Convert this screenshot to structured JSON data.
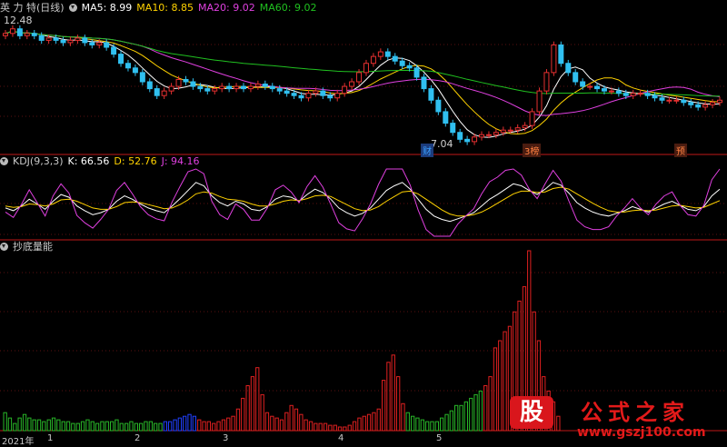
{
  "header": {
    "stock": "英 力 特(日线)",
    "ma": [
      {
        "label": "MA5: 8.99",
        "color": "#ffffff"
      },
      {
        "label": "MA10: 8.85",
        "color": "#ffd200"
      },
      {
        "label": "MA20: 9.02",
        "color": "#e040e0"
      },
      {
        "label": "MA60: 9.02",
        "color": "#20c020"
      }
    ]
  },
  "price_annotations": {
    "high": "12.48",
    "low": "7.04"
  },
  "markers": [
    {
      "text": "财",
      "color": "#3aa0ff"
    },
    {
      "text": "3榜",
      "color": "#ff8040"
    },
    {
      "text": "预",
      "color": "#ff8040"
    }
  ],
  "kdj": {
    "title": "KDJ(9,3,3)",
    "k": "K: 66.56",
    "d": "D: 52.76",
    "j": "J: 94.16",
    "k_color": "#ffffff",
    "d_color": "#ffd200",
    "j_color": "#e040e0"
  },
  "vol": {
    "title": "抄底量能"
  },
  "xaxis": {
    "labels": [
      "2021年",
      "1",
      "2",
      "3",
      "4",
      "5"
    ]
  },
  "watermark": {
    "logo": "股",
    "name": "公式之家",
    "url": "www.gszj100.com"
  },
  "chart_data": [
    {
      "type": "candlestick",
      "title": "英 力 特(日线)",
      "annotations": [
        "12.48",
        "7.04"
      ],
      "moving_averages": [
        "MA5",
        "MA10",
        "MA20",
        "MA60"
      ],
      "closes": [
        11.9,
        12.1,
        11.8,
        11.9,
        11.8,
        11.6,
        11.7,
        11.6,
        11.5,
        11.6,
        11.7,
        11.5,
        11.4,
        11.5,
        11.3,
        11.0,
        10.6,
        10.4,
        10.2,
        9.8,
        9.5,
        9.2,
        9.4,
        9.6,
        9.9,
        9.8,
        9.6,
        9.5,
        9.4,
        9.5,
        9.6,
        9.5,
        9.6,
        9.5,
        9.6,
        9.7,
        9.6,
        9.5,
        9.4,
        9.3,
        9.2,
        9.1,
        9.3,
        9.4,
        9.2,
        9.1,
        9.3,
        9.6,
        9.8,
        10.2,
        10.6,
        10.9,
        11.1,
        10.9,
        10.7,
        10.5,
        10.4,
        10.0,
        9.5,
        9.0,
        8.5,
        8.0,
        7.6,
        7.3,
        7.2,
        7.4,
        7.5,
        7.5,
        7.6,
        7.7,
        7.7,
        7.8,
        7.9,
        8.5,
        9.4,
        10.2,
        11.4,
        10.6,
        10.2,
        9.8,
        9.6,
        9.6,
        9.5,
        9.4,
        9.4,
        9.3,
        9.2,
        9.3,
        9.3,
        9.2,
        9.1,
        9.0,
        9.0,
        9.0,
        8.9,
        8.8,
        8.7,
        8.8,
        8.9,
        9.0
      ]
    },
    {
      "type": "line",
      "title": "KDJ(9,3,3)",
      "series": [
        {
          "name": "K",
          "values": [
            42,
            38,
            45,
            55,
            48,
            40,
            52,
            62,
            58,
            45,
            38,
            32,
            35,
            40,
            52,
            60,
            55,
            48,
            42,
            38,
            35,
            45,
            56,
            68,
            80,
            75,
            60,
            50,
            45,
            52,
            48,
            40,
            38,
            44,
            55,
            60,
            58,
            52,
            62,
            70,
            65,
            55,
            42,
            35,
            30,
            34,
            42,
            55,
            68,
            75,
            80,
            70,
            55,
            40,
            30,
            25,
            22,
            26,
            30,
            35,
            45,
            55,
            62,
            70,
            78,
            75,
            68,
            62,
            70,
            80,
            76,
            64,
            50,
            42,
            36,
            32,
            30,
            34,
            38,
            44,
            40,
            36,
            42,
            48,
            52,
            46,
            40,
            38,
            44,
            60,
            70
          ]
        },
        {
          "name": "D",
          "values": [
            45,
            43,
            44,
            48,
            47,
            45,
            48,
            54,
            55,
            52,
            47,
            42,
            40,
            40,
            44,
            50,
            51,
            50,
            47,
            44,
            41,
            42,
            47,
            54,
            63,
            66,
            64,
            59,
            55,
            54,
            52,
            48,
            45,
            45,
            48,
            52,
            54,
            53,
            56,
            60,
            61,
            59,
            53,
            47,
            41,
            38,
            39,
            44,
            52,
            59,
            66,
            67,
            63,
            55,
            47,
            39,
            33,
            30,
            30,
            32,
            36,
            42,
            49,
            56,
            63,
            67,
            67,
            65,
            66,
            71,
            73,
            70,
            63,
            56,
            49,
            43,
            38,
            36,
            36,
            38,
            39,
            38,
            39,
            42,
            45,
            46,
            44,
            42,
            43,
            48,
            53
          ]
        },
        {
          "name": "J",
          "values": [
            36,
            28,
            47,
            69,
            50,
            30,
            60,
            78,
            64,
            31,
            20,
            12,
            25,
            40,
            68,
            80,
            63,
            44,
            32,
            26,
            23,
            51,
            74,
            96,
            100,
            93,
            52,
            32,
            25,
            48,
            40,
            24,
            24,
            42,
            69,
            76,
            66,
            50,
            74,
            90,
            73,
            47,
            20,
            11,
            8,
            26,
            48,
            77,
            100,
            100,
            100,
            76,
            39,
            10,
            0,
            0,
            0,
            18,
            30,
            41,
            63,
            81,
            88,
            98,
            100,
            91,
            70,
            56,
            78,
            98,
            82,
            52,
            24,
            14,
            10,
            10,
            14,
            30,
            42,
            56,
            42,
            32,
            48,
            60,
            66,
            46,
            32,
            30,
            46,
            84,
            100
          ]
        }
      ]
    },
    {
      "type": "bar",
      "title": "抄底量能",
      "values": [
        10,
        7,
        4,
        7,
        9,
        7,
        6,
        6,
        5,
        6,
        7,
        6,
        5,
        5,
        4,
        4,
        5,
        6,
        5,
        4,
        5,
        5,
        5,
        6,
        4,
        4,
        5,
        4,
        4,
        5,
        5,
        4,
        4,
        5,
        5,
        6,
        7,
        8,
        9,
        8,
        6,
        5,
        5,
        4,
        5,
        6,
        7,
        8,
        12,
        18,
        25,
        30,
        35,
        20,
        10,
        8,
        7,
        6,
        10,
        14,
        12,
        9,
        6,
        5,
        4,
        4,
        4,
        3,
        3,
        2,
        2,
        3,
        5,
        7,
        8,
        9,
        10,
        12,
        28,
        38,
        42,
        30,
        15,
        10,
        8,
        7,
        6,
        5,
        5,
        5,
        7,
        9,
        11,
        14,
        14,
        16,
        18,
        20,
        22,
        25,
        30,
        46,
        50,
        55,
        58,
        66,
        72,
        80,
        100,
        66,
        50,
        30,
        22,
        16,
        8
      ],
      "colors": [
        "g",
        "g",
        "g",
        "g",
        "g",
        "g",
        "g",
        "g",
        "g",
        "g",
        "g",
        "g",
        "g",
        "g",
        "g",
        "g",
        "g",
        "g",
        "g",
        "g",
        "g",
        "g",
        "g",
        "g",
        "g",
        "g",
        "g",
        "g",
        "g",
        "g",
        "g",
        "g",
        "g",
        "b",
        "b",
        "b",
        "b",
        "b",
        "b",
        "b",
        "r",
        "r",
        "r",
        "r",
        "r",
        "r",
        "r",
        "r",
        "r",
        "r",
        "r",
        "r",
        "r",
        "r",
        "r",
        "r",
        "r",
        "r",
        "r",
        "r",
        "r",
        "r",
        "r",
        "r",
        "r",
        "r",
        "r",
        "r",
        "r",
        "r",
        "r",
        "r",
        "r",
        "r",
        "r",
        "r",
        "r",
        "r",
        "r",
        "r",
        "r",
        "r",
        "r",
        "g",
        "g",
        "g",
        "g",
        "g",
        "g",
        "g",
        "g",
        "g",
        "g",
        "g",
        "g",
        "g",
        "g",
        "g",
        "g",
        "r",
        "r",
        "r",
        "r",
        "r",
        "r",
        "r",
        "r",
        "r",
        "r",
        "r",
        "r",
        "r",
        "r",
        "r",
        "r"
      ]
    }
  ]
}
